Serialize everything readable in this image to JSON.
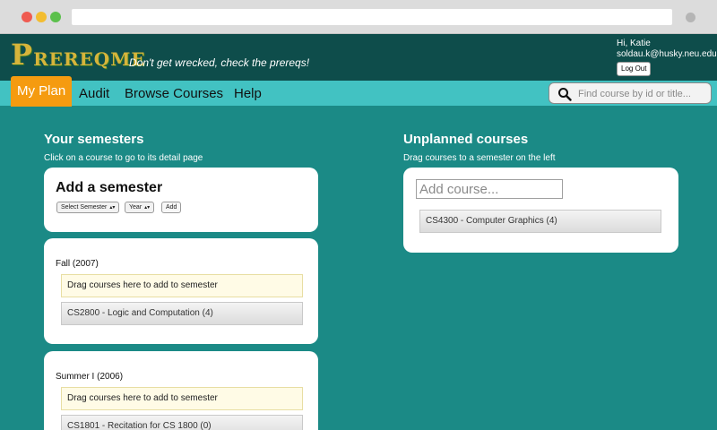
{
  "browser": {
    "address": ""
  },
  "header": {
    "logo_big": "P",
    "logo_rest": "REREQ",
    "logo_me": "ME",
    "tagline": "Don't get wrecked, check the prereqs!",
    "greeting": "Hi, Katie",
    "email": "soldau.k@husky.neu.edu",
    "logout_label": "Log Out"
  },
  "nav": {
    "items": [
      "My Plan",
      "Audit",
      "Browse Courses",
      "Help"
    ],
    "search_placeholder": "Find course by id or title..."
  },
  "left": {
    "title": "Your semesters",
    "subtitle": "Click on a course to go to its detail page",
    "add_semester": {
      "title": "Add a semester",
      "semester_select": "Select Semester",
      "year_select": "Year",
      "add_button": "Add"
    },
    "semesters": [
      {
        "name": "Fall (2007)",
        "dropzone": "Drag courses here to add to semester",
        "courses": [
          "CS2800 - Logic and Computation (4)"
        ]
      },
      {
        "name": "Summer I (2006)",
        "dropzone": "Drag courses here to add to semester",
        "courses": [
          "CS1801 - Recitation for CS 1800 (0)"
        ]
      }
    ]
  },
  "right": {
    "title": "Unplanned courses",
    "subtitle": "Drag courses to a semester on the left",
    "add_placeholder": "Add course...",
    "courses": [
      "CS4300 - Computer Graphics (4)"
    ]
  },
  "colors": {
    "background": "#1b8a86",
    "header": "#0e4d4b",
    "nav": "#42c2c2",
    "active_tab": "#f59b10",
    "logo": "#d6b43b"
  }
}
